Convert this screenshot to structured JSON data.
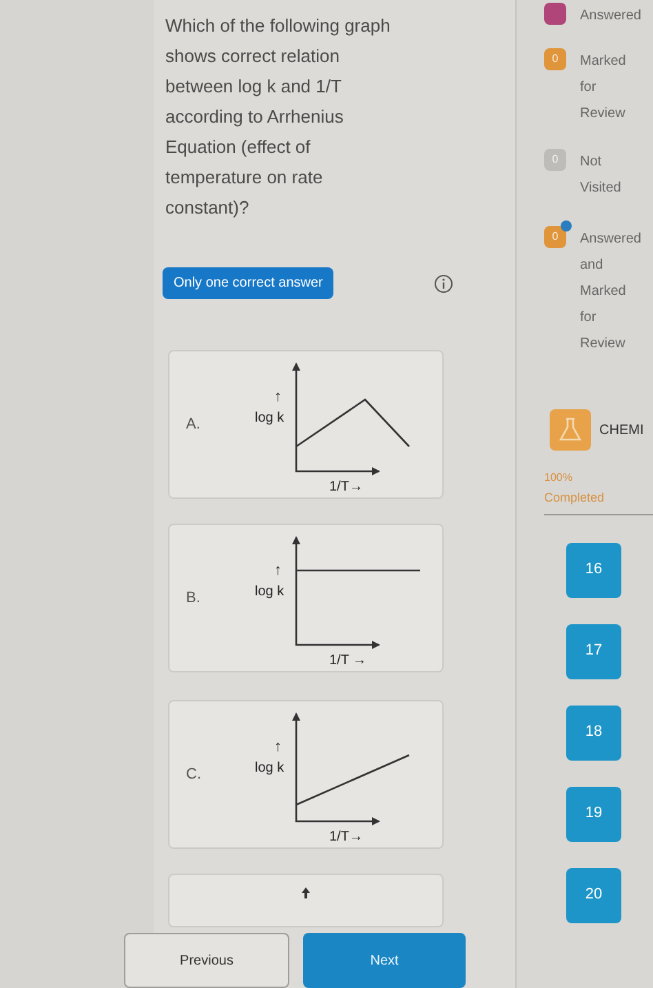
{
  "question": {
    "text": "Which of the following graph shows correct relation between log k and 1/T according to Arrhenius Equation (effect of temperature on rate constant)?",
    "answer_type": "Only one correct answer"
  },
  "options": [
    {
      "label": "A.",
      "kind": "peak",
      "y_arrow": "↑",
      "y_label": "log k",
      "x_label": "1/T→"
    },
    {
      "label": "B.",
      "kind": "flat",
      "y_arrow": "↑",
      "y_label": "log k",
      "x_label": "1/T →"
    },
    {
      "label": "C.",
      "kind": "rising",
      "y_arrow": "↑",
      "y_label": "log k",
      "x_label": "1/T→"
    },
    {
      "kind": "cut"
    }
  ],
  "footer": {
    "previous": "Previous",
    "next": "Next"
  },
  "legend": [
    {
      "kind": "not_answered",
      "lines": [
        "Answered"
      ]
    },
    {
      "kind": "marked",
      "count": "0",
      "lines": [
        "Marked",
        "for",
        "Review"
      ]
    },
    {
      "kind": "not_visited",
      "count": "0",
      "lines": [
        "Not",
        "Visited"
      ]
    },
    {
      "kind": "answered_marked",
      "count": "0",
      "lines": [
        "Answered",
        "and",
        "Marked",
        "for",
        "Review"
      ]
    }
  ],
  "subject": {
    "name": "CHEMI",
    "progress": "100%",
    "progress_label": "Completed"
  },
  "question_numbers": [
    "16",
    "17",
    "18",
    "19",
    "20"
  ]
}
